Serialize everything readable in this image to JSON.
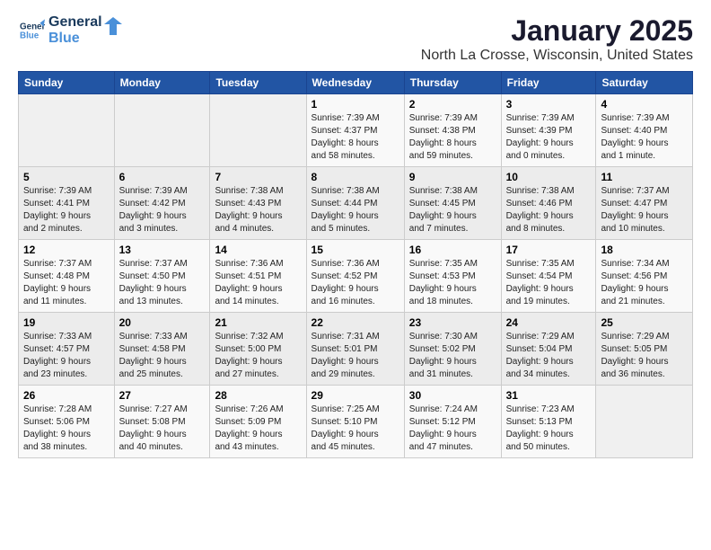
{
  "logo": {
    "line1": "General",
    "line2": "Blue"
  },
  "title": "January 2025",
  "subtitle": "North La Crosse, Wisconsin, United States",
  "days_header": [
    "Sunday",
    "Monday",
    "Tuesday",
    "Wednesday",
    "Thursday",
    "Friday",
    "Saturday"
  ],
  "weeks": [
    [
      {
        "day": "",
        "info": ""
      },
      {
        "day": "",
        "info": ""
      },
      {
        "day": "",
        "info": ""
      },
      {
        "day": "1",
        "info": "Sunrise: 7:39 AM\nSunset: 4:37 PM\nDaylight: 8 hours\nand 58 minutes."
      },
      {
        "day": "2",
        "info": "Sunrise: 7:39 AM\nSunset: 4:38 PM\nDaylight: 8 hours\nand 59 minutes."
      },
      {
        "day": "3",
        "info": "Sunrise: 7:39 AM\nSunset: 4:39 PM\nDaylight: 9 hours\nand 0 minutes."
      },
      {
        "day": "4",
        "info": "Sunrise: 7:39 AM\nSunset: 4:40 PM\nDaylight: 9 hours\nand 1 minute."
      }
    ],
    [
      {
        "day": "5",
        "info": "Sunrise: 7:39 AM\nSunset: 4:41 PM\nDaylight: 9 hours\nand 2 minutes."
      },
      {
        "day": "6",
        "info": "Sunrise: 7:39 AM\nSunset: 4:42 PM\nDaylight: 9 hours\nand 3 minutes."
      },
      {
        "day": "7",
        "info": "Sunrise: 7:38 AM\nSunset: 4:43 PM\nDaylight: 9 hours\nand 4 minutes."
      },
      {
        "day": "8",
        "info": "Sunrise: 7:38 AM\nSunset: 4:44 PM\nDaylight: 9 hours\nand 5 minutes."
      },
      {
        "day": "9",
        "info": "Sunrise: 7:38 AM\nSunset: 4:45 PM\nDaylight: 9 hours\nand 7 minutes."
      },
      {
        "day": "10",
        "info": "Sunrise: 7:38 AM\nSunset: 4:46 PM\nDaylight: 9 hours\nand 8 minutes."
      },
      {
        "day": "11",
        "info": "Sunrise: 7:37 AM\nSunset: 4:47 PM\nDaylight: 9 hours\nand 10 minutes."
      }
    ],
    [
      {
        "day": "12",
        "info": "Sunrise: 7:37 AM\nSunset: 4:48 PM\nDaylight: 9 hours\nand 11 minutes."
      },
      {
        "day": "13",
        "info": "Sunrise: 7:37 AM\nSunset: 4:50 PM\nDaylight: 9 hours\nand 13 minutes."
      },
      {
        "day": "14",
        "info": "Sunrise: 7:36 AM\nSunset: 4:51 PM\nDaylight: 9 hours\nand 14 minutes."
      },
      {
        "day": "15",
        "info": "Sunrise: 7:36 AM\nSunset: 4:52 PM\nDaylight: 9 hours\nand 16 minutes."
      },
      {
        "day": "16",
        "info": "Sunrise: 7:35 AM\nSunset: 4:53 PM\nDaylight: 9 hours\nand 18 minutes."
      },
      {
        "day": "17",
        "info": "Sunrise: 7:35 AM\nSunset: 4:54 PM\nDaylight: 9 hours\nand 19 minutes."
      },
      {
        "day": "18",
        "info": "Sunrise: 7:34 AM\nSunset: 4:56 PM\nDaylight: 9 hours\nand 21 minutes."
      }
    ],
    [
      {
        "day": "19",
        "info": "Sunrise: 7:33 AM\nSunset: 4:57 PM\nDaylight: 9 hours\nand 23 minutes."
      },
      {
        "day": "20",
        "info": "Sunrise: 7:33 AM\nSunset: 4:58 PM\nDaylight: 9 hours\nand 25 minutes."
      },
      {
        "day": "21",
        "info": "Sunrise: 7:32 AM\nSunset: 5:00 PM\nDaylight: 9 hours\nand 27 minutes."
      },
      {
        "day": "22",
        "info": "Sunrise: 7:31 AM\nSunset: 5:01 PM\nDaylight: 9 hours\nand 29 minutes."
      },
      {
        "day": "23",
        "info": "Sunrise: 7:30 AM\nSunset: 5:02 PM\nDaylight: 9 hours\nand 31 minutes."
      },
      {
        "day": "24",
        "info": "Sunrise: 7:29 AM\nSunset: 5:04 PM\nDaylight: 9 hours\nand 34 minutes."
      },
      {
        "day": "25",
        "info": "Sunrise: 7:29 AM\nSunset: 5:05 PM\nDaylight: 9 hours\nand 36 minutes."
      }
    ],
    [
      {
        "day": "26",
        "info": "Sunrise: 7:28 AM\nSunset: 5:06 PM\nDaylight: 9 hours\nand 38 minutes."
      },
      {
        "day": "27",
        "info": "Sunrise: 7:27 AM\nSunset: 5:08 PM\nDaylight: 9 hours\nand 40 minutes."
      },
      {
        "day": "28",
        "info": "Sunrise: 7:26 AM\nSunset: 5:09 PM\nDaylight: 9 hours\nand 43 minutes."
      },
      {
        "day": "29",
        "info": "Sunrise: 7:25 AM\nSunset: 5:10 PM\nDaylight: 9 hours\nand 45 minutes."
      },
      {
        "day": "30",
        "info": "Sunrise: 7:24 AM\nSunset: 5:12 PM\nDaylight: 9 hours\nand 47 minutes."
      },
      {
        "day": "31",
        "info": "Sunrise: 7:23 AM\nSunset: 5:13 PM\nDaylight: 9 hours\nand 50 minutes."
      },
      {
        "day": "",
        "info": ""
      }
    ]
  ]
}
